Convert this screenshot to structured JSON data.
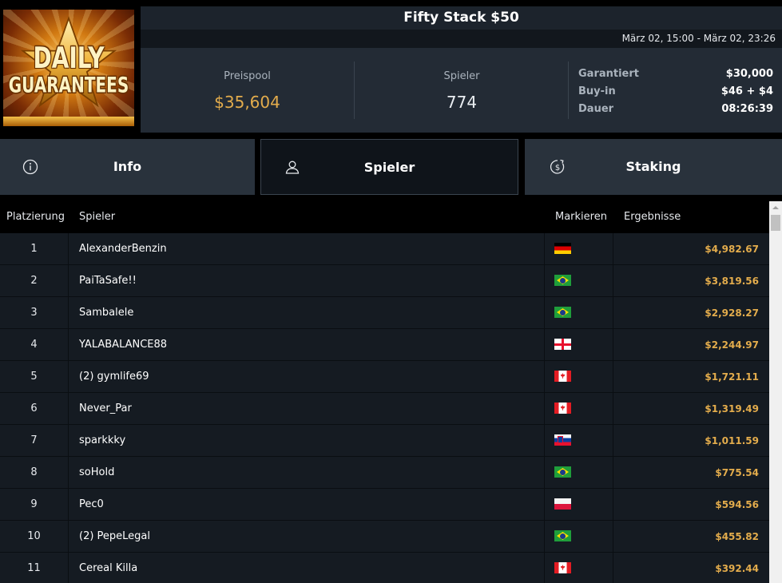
{
  "logo": {
    "line1": "DAILY",
    "line2": "GUARANTEES"
  },
  "header": {
    "title": "Fifty Stack $50",
    "date_range": "März 02, 15:00 - März 02, 23:26"
  },
  "stats": {
    "prizepool_label": "Preispool",
    "prizepool_value": "$35,604",
    "players_label": "Spieler",
    "players_value": "774",
    "details": [
      {
        "label": "Garantiert",
        "value": "$30,000"
      },
      {
        "label": "Buy-in",
        "value": "$46 + $4"
      },
      {
        "label": "Dauer",
        "value": "08:26:39"
      }
    ]
  },
  "tabs": [
    {
      "label": "Info",
      "icon": "info-icon"
    },
    {
      "label": "Spieler",
      "icon": "user-icon",
      "active": true
    },
    {
      "label": "Staking",
      "icon": "dollar-coin-icon"
    }
  ],
  "table": {
    "headers": {
      "rank": "Platzierung",
      "player": "Spieler",
      "flag": "Markieren",
      "result": "Ergebnisse"
    },
    "rows": [
      {
        "rank": "1",
        "player": "AlexanderBenzin",
        "flag": "de",
        "result": "$4,982.67"
      },
      {
        "rank": "2",
        "player": "PaiTaSafe!!",
        "flag": "br",
        "result": "$3,819.56"
      },
      {
        "rank": "3",
        "player": "Sambalele",
        "flag": "br",
        "result": "$2,928.27"
      },
      {
        "rank": "4",
        "player": "YALABALANCE88",
        "flag": "ge",
        "result": "$2,244.97"
      },
      {
        "rank": "5",
        "player": "(2) gymlife69",
        "flag": "ca",
        "result": "$1,721.11"
      },
      {
        "rank": "6",
        "player": "Never_Par",
        "flag": "ca",
        "result": "$1,319.49"
      },
      {
        "rank": "7",
        "player": "sparkkky",
        "flag": "si",
        "result": "$1,011.59"
      },
      {
        "rank": "8",
        "player": "soHold",
        "flag": "br",
        "result": "$775.54"
      },
      {
        "rank": "9",
        "player": "Pec0",
        "flag": "pl",
        "result": "$594.56"
      },
      {
        "rank": "10",
        "player": "(2) PepeLegal",
        "flag": "br",
        "result": "$455.82"
      },
      {
        "rank": "11",
        "player": "Cereal Killa",
        "flag": "ca",
        "result": "$392.44"
      }
    ]
  },
  "colors": {
    "accent_gold": "#e3ac4c",
    "panel": "#232b35",
    "row": "#151b22"
  }
}
